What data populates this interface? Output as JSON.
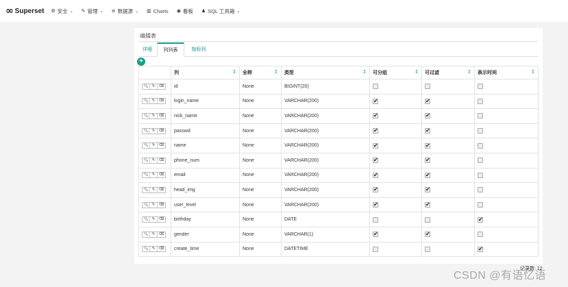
{
  "brand": {
    "name": "Superset",
    "logo": "∞"
  },
  "nav": [
    {
      "icon": "⚙",
      "label": "安全",
      "caret": true
    },
    {
      "icon": "🔧",
      "label": "管理",
      "caret": true
    },
    {
      "icon": "≡",
      "label": "数据源",
      "caret": true
    },
    {
      "icon": "▥",
      "label": "Charts",
      "caret": false
    },
    {
      "icon": "◉",
      "label": "看板",
      "caret": false
    },
    {
      "icon": "♟",
      "label": "SQL 工具箱",
      "caret": true
    }
  ],
  "panel": {
    "title": "编辑表",
    "tabs": [
      "详细",
      "列列表",
      "指标列"
    ],
    "active_tab": "列列表"
  },
  "table": {
    "headers": [
      "列",
      "全称",
      "类型",
      "可分组",
      "可过滤",
      "表示时间"
    ],
    "rows": [
      {
        "col": "id",
        "full": "None",
        "type": "BIGINT(20)",
        "group": false,
        "filter": false,
        "time": false
      },
      {
        "col": "login_name",
        "full": "None",
        "type": "VARCHAR(200)",
        "group": true,
        "filter": true,
        "time": false
      },
      {
        "col": "nick_name",
        "full": "None",
        "type": "VARCHAR(200)",
        "group": true,
        "filter": true,
        "time": false
      },
      {
        "col": "passwd",
        "full": "None",
        "type": "VARCHAR(200)",
        "group": true,
        "filter": true,
        "time": false
      },
      {
        "col": "name",
        "full": "None",
        "type": "VARCHAR(200)",
        "group": true,
        "filter": true,
        "time": false
      },
      {
        "col": "phone_num",
        "full": "None",
        "type": "VARCHAR(200)",
        "group": true,
        "filter": true,
        "time": false
      },
      {
        "col": "email",
        "full": "None",
        "type": "VARCHAR(200)",
        "group": true,
        "filter": true,
        "time": false
      },
      {
        "col": "head_img",
        "full": "None",
        "type": "VARCHAR(200)",
        "group": true,
        "filter": true,
        "time": false
      },
      {
        "col": "user_level",
        "full": "None",
        "type": "VARCHAR(200)",
        "group": true,
        "filter": true,
        "time": false
      },
      {
        "col": "birthday",
        "full": "None",
        "type": "DATE",
        "group": false,
        "filter": false,
        "time": true
      },
      {
        "col": "gender",
        "full": "None",
        "type": "VARCHAR(1)",
        "group": true,
        "filter": true,
        "time": false
      },
      {
        "col": "create_time",
        "full": "None",
        "type": "DATETIME",
        "group": false,
        "filter": false,
        "time": true
      }
    ]
  },
  "record_count": "记录数: 12",
  "watermark": "CSDN @有语忆语",
  "colors": {
    "accent": "#1a9a8c"
  }
}
